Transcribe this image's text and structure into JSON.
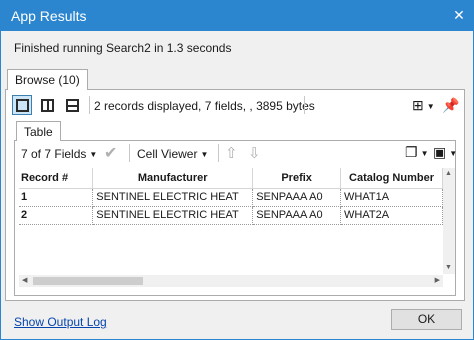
{
  "window": {
    "title": "App Results",
    "close_glyph": "✕"
  },
  "status": "Finished running Search2 in 1.3 seconds",
  "outer_tab": {
    "label": "Browse (10)"
  },
  "toolbar": {
    "summary": "2 records displayed, 7 fields, , 3895 bytes",
    "icons": [
      "single-view-icon",
      "side-by-side-view-icon",
      "stacked-view-icon",
      "add-column-icon",
      "pin-icon"
    ]
  },
  "inner_tab": {
    "label": "Table"
  },
  "table_toolbar": {
    "fields_selector": "7 of 7 Fields",
    "cell_viewer": "Cell Viewer",
    "icons": [
      "checkmark-icon",
      "move-up-icon",
      "move-down-icon",
      "copy-icon",
      "save-icon"
    ]
  },
  "grid": {
    "columns": [
      "Record #",
      "Manufacturer",
      "Prefix",
      "Catalog Number"
    ],
    "rows": [
      [
        "1",
        "SENTINEL ELECTRIC HEAT",
        "SENPAAA A0",
        "WHAT1A"
      ],
      [
        "2",
        "SENTINEL ELECTRIC HEAT",
        "SENPAAA A0",
        "WHAT2A"
      ]
    ]
  },
  "footer": {
    "link": "Show Output Log",
    "ok": "OK"
  },
  "colors": {
    "titlebar": "#2b86cf",
    "selected_view": "#cde6f7",
    "link": "#0645ad"
  }
}
